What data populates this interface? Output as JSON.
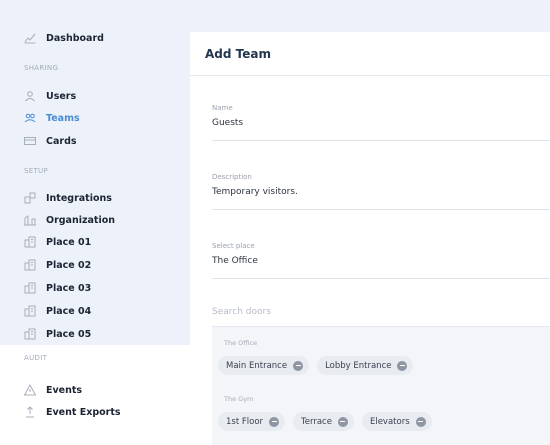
{
  "sidebar": {
    "dashboard": "Dashboard",
    "section_sharing": "SHARING",
    "users": "Users",
    "teams": "Teams",
    "cards": "Cards",
    "section_setup": "SETUP",
    "integrations": "Integrations",
    "organization": "Organization",
    "places": [
      "Place 01",
      "Place 02",
      "Place 03",
      "Place 04",
      "Place 05"
    ],
    "section_audit": "AUDIT",
    "events": "Events",
    "event_exports": "Event Exports"
  },
  "form": {
    "title": "Add Team",
    "name_label": "Name",
    "name_value": "Guests",
    "description_label": "Description",
    "description_value": "Temporary visitors.",
    "place_label": "Select place",
    "place_value": "The Office",
    "search_placeholder": "Search doors",
    "groups": [
      {
        "label": "The Office",
        "doors": [
          "Main Entrance",
          "Lobby Entrance"
        ]
      },
      {
        "label": "The Gym",
        "doors": [
          "1st Floor",
          "Terrace",
          "Elevators"
        ]
      }
    ]
  },
  "colors": {
    "accent": "#4a8cd6",
    "text_dark": "#1d2433",
    "background": "#edf1f9"
  }
}
